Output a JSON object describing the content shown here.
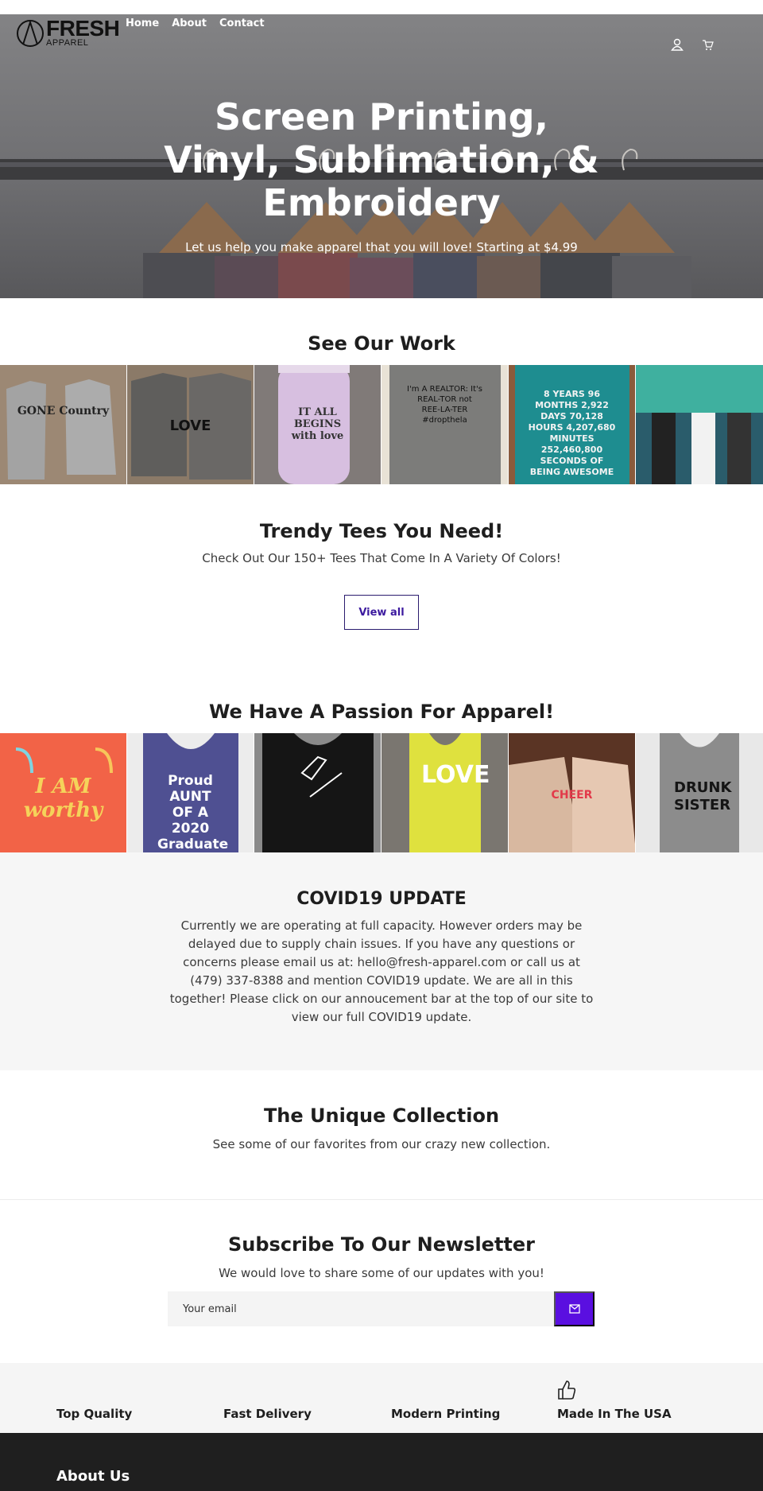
{
  "header": {
    "logo_text": "FRESH",
    "logo_sub": "APPAREL",
    "nav": [
      "Home",
      "About",
      "Contact"
    ],
    "icons": [
      "account-icon",
      "cart-icon"
    ]
  },
  "hero": {
    "title": "Screen Printing, Vinyl, Sublimation, & Embroidery",
    "subtitle": "Let us help you make apparel that you will love! Starting at $4.99"
  },
  "work": {
    "title": "See Our Work",
    "tiles": [
      {
        "text": "GONE Country",
        "bg": "#8c7a66"
      },
      {
        "text": "LOVE",
        "bg": "#6b655f"
      },
      {
        "text": "IT ALL BEGINS with love",
        "bg": "#cdb7d6"
      },
      {
        "text": "I'm A REALTOR: It's REAL-TOR not REE-LA-TER #dropthela",
        "bg": "#7a7a78"
      },
      {
        "text": "8 YEARS 96 MONTHS 2,922 DAYS 70,128 HOURS 4,207,680 MINUTES 252,460,800 SECONDS OF BEING AWESOME",
        "bg": "#1f8a8e"
      },
      {
        "text": "",
        "bg": "#3fae9f"
      }
    ]
  },
  "trendy": {
    "title": "Trendy Tees You Need!",
    "subtitle": "Check Out Our 150+ Tees That Come In A Variety Of Colors!",
    "button": "View all"
  },
  "passion": {
    "title": "We Have A Passion For Apparel!",
    "tiles": [
      {
        "text": "I AM worthy",
        "bg": "#f0644a"
      },
      {
        "text": "Proud AUNT OF A 2020 Graduate",
        "bg": "#4e4f8f"
      },
      {
        "text": "",
        "bg": "#1a1a1a"
      },
      {
        "text": "LOVE",
        "bg": "#dede3a"
      },
      {
        "text": "CHEER",
        "bg": "#6a3b2a"
      },
      {
        "text": "DRUNK SISTER",
        "bg": "#8a8a8a"
      }
    ]
  },
  "covid": {
    "title": "COVID19 UPDATE",
    "text": "Currently we are operating at full capacity. However orders may be delayed due to supply chain issues. If you have any questions or concerns please email us at: hello@fresh-apparel.com or call us at (479) 337-8388 and mention COVID19 update. We are all in this together! Please click on our annoucement bar at the top of our site to view our full COVID19 update."
  },
  "collection": {
    "title": "The Unique Collection",
    "subtitle": "See some of our favorites from our crazy new collection."
  },
  "newsletter": {
    "title": "Subscribe To Our Newsletter",
    "subtitle": "We would love to share some of our updates with you!",
    "placeholder": "Your email"
  },
  "features": [
    "Top Quality",
    "Fast Delivery",
    "Modern Printing",
    "Made In The USA"
  ],
  "footer": {
    "title": "About Us"
  },
  "colors": {
    "accent": "#5a0fe0",
    "button_text": "#3c1a9f",
    "footer_bg": "#1f1f1f"
  }
}
